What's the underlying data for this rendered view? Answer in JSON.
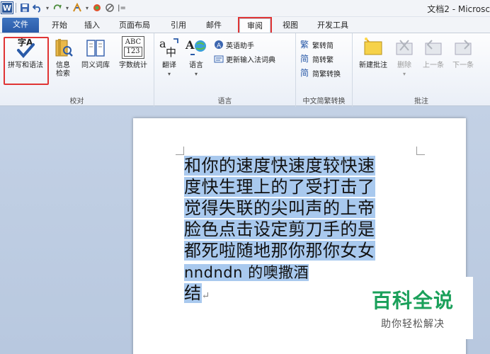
{
  "window": {
    "title": "文档2 - Microsc"
  },
  "quick_access": {
    "customize_glyph": "|="
  },
  "tabs": [
    {
      "label": "文件"
    },
    {
      "label": "开始"
    },
    {
      "label": "插入"
    },
    {
      "label": "页面布局"
    },
    {
      "label": "引用"
    },
    {
      "label": "邮件"
    },
    {
      "label": "审阅",
      "active": true,
      "highlighted": true
    },
    {
      "label": "视图"
    },
    {
      "label": "开发工具"
    }
  ],
  "ribbon": {
    "proofing": {
      "label": "校对",
      "spelling": "拼写和语法",
      "research_line1": "信息",
      "research_line2": "检索",
      "thesaurus": "同义词库",
      "word_count": "字数统计",
      "abc": "ABC",
      "num": "123"
    },
    "language": {
      "label": "语言",
      "translate": "翻译",
      "language": "语言",
      "english_assistant": "英语助手",
      "update_ime": "更新输入法词典"
    },
    "chinese_conversion": {
      "label": "中文简繁转换",
      "to_simplified": "繁转简",
      "to_traditional": "简转繁",
      "conversion": "简繁转换"
    },
    "comments": {
      "label": "批注",
      "new_comment": "新建批注",
      "delete": "删除",
      "previous": "上一条",
      "next": "下一条"
    }
  },
  "document": {
    "lines": [
      "和你的速度快速度较快速",
      "度快生理上的了受打击了",
      "觉得失联的尖叫声的上帝",
      "脸色点击设定剪刀手的是",
      "都死啦随地那你那你女女",
      "nndndn  的噢撒酒",
      "结"
    ]
  },
  "watermark": {
    "title": "百科全说",
    "subtitle": "助你轻松解决"
  },
  "colors": {
    "highlight_box": "#e03434",
    "selection": "#a9c9ee",
    "watermark_green": "#1aa05a"
  }
}
